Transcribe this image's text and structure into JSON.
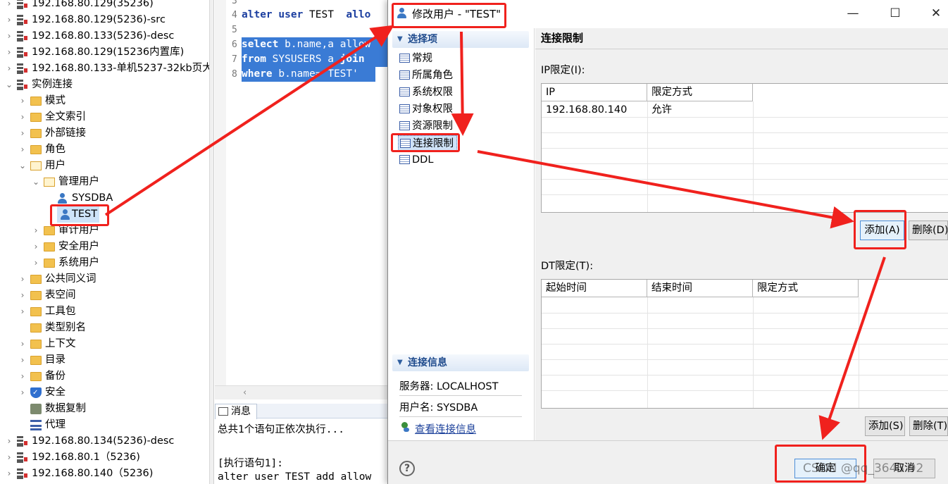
{
  "tree": {
    "nodes": [
      {
        "label": "192.168.80.129(35236)",
        "type": "server",
        "chev": "›"
      },
      {
        "label": "192.168.80.129(5236)-src",
        "type": "server",
        "chev": "›"
      },
      {
        "label": "192.168.80.133(5236)-desc",
        "type": "server",
        "chev": "›"
      },
      {
        "label": "192.168.80.129(15236内置库)",
        "type": "server",
        "chev": "›"
      },
      {
        "label": "192.168.80.133-单机5237-32kb页大",
        "type": "server",
        "chev": "›"
      },
      {
        "label": "实例连接",
        "type": "server",
        "chev": "⌄"
      },
      {
        "label": "模式",
        "type": "folder",
        "chev": "›"
      },
      {
        "label": "全文索引",
        "type": "folder",
        "chev": "›"
      },
      {
        "label": "外部链接",
        "type": "folder",
        "chev": "›"
      },
      {
        "label": "角色",
        "type": "folder",
        "chev": "›"
      },
      {
        "label": "用户",
        "type": "folder-open",
        "chev": "⌄"
      },
      {
        "label": "管理用户",
        "type": "folder-open",
        "chev": "⌄"
      },
      {
        "label": "SYSDBA",
        "type": "user",
        "chev": ""
      },
      {
        "label": "TEST",
        "type": "user",
        "chev": ""
      },
      {
        "label": "审计用户",
        "type": "folder",
        "chev": "›"
      },
      {
        "label": "安全用户",
        "type": "folder",
        "chev": "›"
      },
      {
        "label": "系统用户",
        "type": "folder",
        "chev": "›"
      },
      {
        "label": "公共同义词",
        "type": "folder",
        "chev": "›"
      },
      {
        "label": "表空间",
        "type": "folder",
        "chev": "›"
      },
      {
        "label": "工具包",
        "type": "folder",
        "chev": "›"
      },
      {
        "label": "类型别名",
        "type": "folder",
        "chev": ""
      },
      {
        "label": "上下文",
        "type": "folder",
        "chev": "›"
      },
      {
        "label": "目录",
        "type": "folder",
        "chev": "›"
      },
      {
        "label": "备份",
        "type": "folder",
        "chev": "›"
      },
      {
        "label": "安全",
        "type": "shield",
        "chev": "›"
      },
      {
        "label": "数据复制",
        "type": "copy",
        "chev": ""
      },
      {
        "label": "代理",
        "type": "layers",
        "chev": ""
      },
      {
        "label": "192.168.80.134(5236)-desc",
        "type": "server",
        "chev": "›"
      },
      {
        "label": "192.168.80.1（5236)",
        "type": "server",
        "chev": "›"
      },
      {
        "label": "192.168.80.140（5236)",
        "type": "server",
        "chev": "›"
      }
    ]
  },
  "editor": {
    "line_numbers": [
      "3",
      "4",
      "5",
      "6",
      "7",
      "8"
    ],
    "line4": {
      "kw1": "alter",
      "kw2": "user",
      "rest": " TEST  ",
      "kw3": "allo"
    },
    "line6": {
      "kw": "select",
      "rest": " b.name,a allow"
    },
    "line7": {
      "kw": "from",
      "rest": " SYSUSERS a ",
      "kw2": "join"
    },
    "line8": {
      "kw": "where",
      "rest": " b.name='TEST'"
    },
    "hscroll_arrow": "‹"
  },
  "messages": {
    "tab_label": "消息",
    "lines": [
      "总共1个语句正依次执行...",
      "",
      "[执行语句1]:",
      "alter user TEST add allow"
    ]
  },
  "dialog": {
    "title": "修改用户 - \"TEST\"",
    "win_minimize": "—",
    "win_maximize": "☐",
    "win_close": "✕",
    "nav_section": "选择项",
    "nav_items": [
      "常规",
      "所属角色",
      "系统权限",
      "对象权限",
      "资源限制",
      "连接限制",
      "DDL"
    ],
    "info_section": "连接信息",
    "server_line": "服务器: LOCALHOST",
    "user_line": "用户名: SYSDBA",
    "info_link": "查看连接信息",
    "content_title": "连接限制",
    "ip_group_label": "IP限定(I):",
    "ip_headers": [
      "IP",
      "限定方式"
    ],
    "ip_rows": [
      [
        "192.168.80.140",
        "允许"
      ]
    ],
    "ip_add": "添加(A)",
    "ip_delete": "删除(D)",
    "dt_group_label": "DT限定(T):",
    "dt_headers": [
      "起始时间",
      "结束时间",
      "限定方式"
    ],
    "dt_add": "添加(S)",
    "dt_delete": "删除(T)",
    "ok": "确定",
    "cancel": "取消",
    "help": "?"
  },
  "watermark": "CSDN @qq_3643 92",
  "colors": {
    "annotation": "#f0211d",
    "selection": "#3a7bd5",
    "keyword": "#1c3fa0"
  }
}
